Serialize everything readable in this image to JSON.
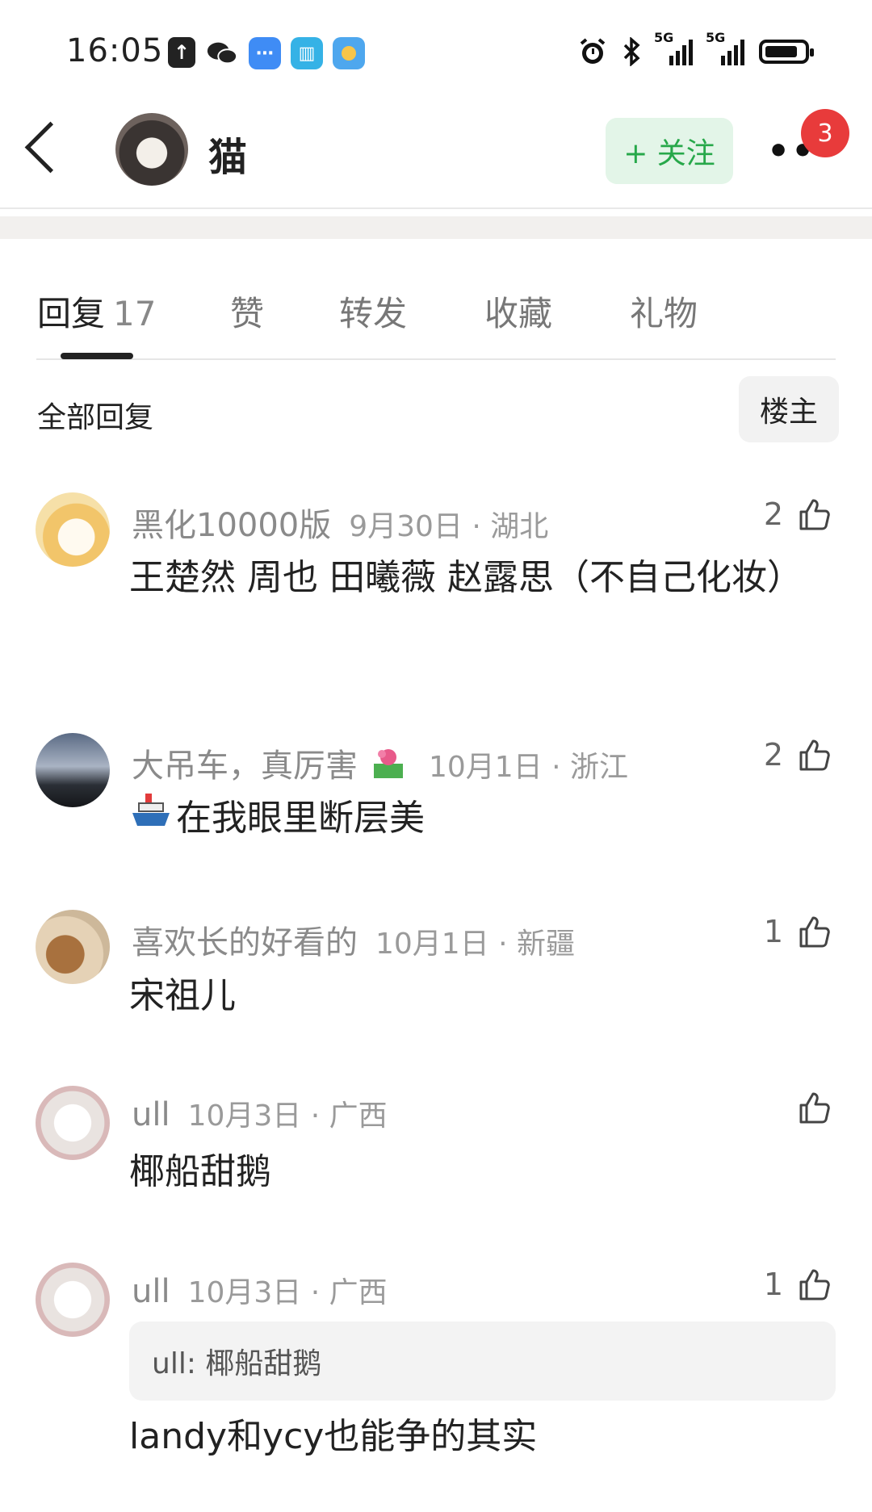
{
  "status_bar": {
    "time": "16:05",
    "network_1": "5G",
    "network_2": "5G",
    "icons": [
      "upload-icon",
      "wechat-icon",
      "message-icon",
      "book-icon",
      "weather-icon",
      "alarm-icon",
      "bluetooth-icon",
      "signal-icon",
      "battery-icon"
    ]
  },
  "header": {
    "title": "猫",
    "follow_label": "+ 关注",
    "badge_count": "3"
  },
  "tabs": [
    {
      "label": "回复",
      "count": "17"
    },
    {
      "label": "赞"
    },
    {
      "label": "转发"
    },
    {
      "label": "收藏"
    },
    {
      "label": "礼物"
    }
  ],
  "filter": {
    "label": "全部回复",
    "op_button": "楼主"
  },
  "comments": [
    {
      "name": "黑化10000版",
      "date": "9月30日 · 湖北",
      "likes": "2",
      "body": "王楚然 周也 田曦薇 赵露思（不自己化妆）"
    },
    {
      "name": "大吊车，真厉害",
      "date": "10月1日 · 浙江",
      "likes": "2",
      "body": "在我眼里断层美"
    },
    {
      "name": "喜欢长的好看的",
      "date": "10月1日 · 新疆",
      "likes": "1",
      "body": "宋祖儿"
    },
    {
      "name": "ull",
      "date": "10月3日 · 广西",
      "likes": "",
      "body": "椰船甜鹅"
    },
    {
      "name": "ull",
      "date": "10月3日 · 广西",
      "likes": "1",
      "quote": "ull: 椰船甜鹅",
      "body": "landy和ycy也能争的其实"
    }
  ],
  "colors": {
    "accent_green": "#27a84a",
    "follow_bg": "#e3f5e8",
    "badge_red": "#e83b3b"
  }
}
